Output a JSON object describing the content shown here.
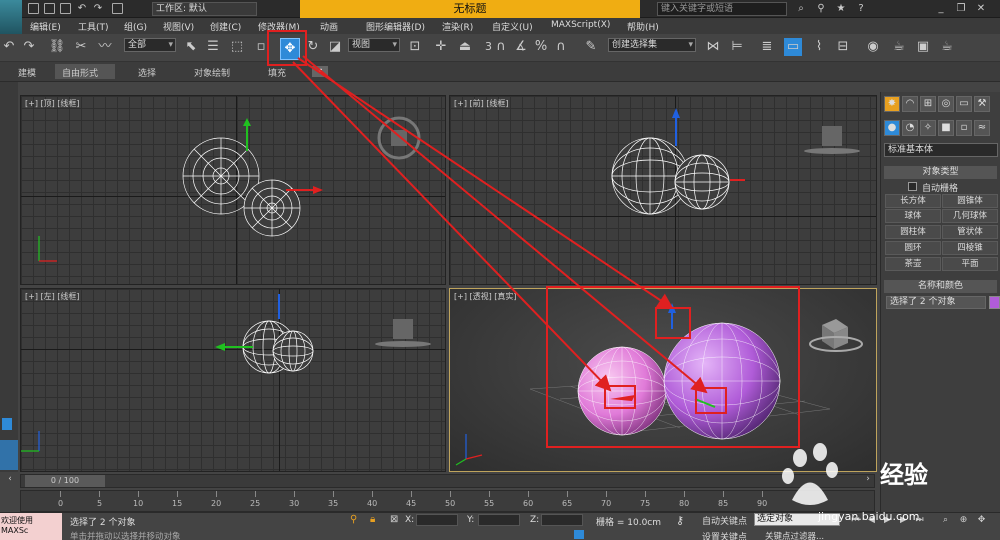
{
  "title_bar": {
    "workspace": "工作区: 默认",
    "title": "无标题",
    "search_placeholder": "键入关键字或短语"
  },
  "menu": [
    "编辑(E)",
    "工具(T)",
    "组(G)",
    "视图(V)",
    "创建(C)",
    "修改器(M)",
    "动画",
    "图形编辑器(D)",
    "渲染(R)",
    "自定义(U)",
    "MAXScript(X)",
    "帮助(H)"
  ],
  "toolbar": {
    "filter_select": "全部",
    "view_select": "视图",
    "create_selection_set": "创建选择集",
    "snap_label": "3"
  },
  "ribbon_tabs": [
    "建模",
    "自由形式",
    "选择",
    "对象绘制",
    "填充"
  ],
  "viewports": {
    "top": "[+] [顶] [线框]",
    "front": "[+] [前] [线框]",
    "left": "[+] [左] [线框]",
    "persp": "[+] [透视] [真实]"
  },
  "command_panel": {
    "dropdown": "标准基本体",
    "object_type_header": "对象类型",
    "autogrid_label": "自动栅格",
    "buttons": [
      "长方体",
      "圆锥体",
      "球体",
      "几何球体",
      "圆柱体",
      "管状体",
      "圆环",
      "四棱锥",
      "茶壶",
      "平面"
    ],
    "name_color_header": "名称和颜色",
    "name_field": "选择了 2 个对象",
    "object_color": "#b05cd8"
  },
  "timeline": {
    "frame_indicator": "0 / 100",
    "ticks": [
      "0",
      "5",
      "10",
      "15",
      "20",
      "25",
      "30",
      "35",
      "40",
      "45",
      "50",
      "55",
      "60",
      "65",
      "70",
      "75",
      "80",
      "85",
      "90"
    ]
  },
  "status": {
    "maxscript": "欢迎使用 MAXSc",
    "selected": "选择了 2 个对象",
    "prompt": "单击并拖动以选择并移动对象",
    "x_label": "X:",
    "y_label": "Y:",
    "z_label": "Z:",
    "grid": "栅格 = 10.0cm",
    "auto_key": "自动关键点",
    "set_key": "设置关键点",
    "selection_filter": "选定对象",
    "key_filter": "关键点过滤器..."
  },
  "colors": {
    "accent_blue": "#2e8ad8",
    "title_orange": "#f0ad12",
    "annotation_red": "#e02020",
    "sphere_pink": "#e07ad8",
    "sphere_purple": "#b05cd8"
  },
  "watermark": {
    "logo_text": "Bai du 经验",
    "url": "jingyan.baidu.com"
  }
}
